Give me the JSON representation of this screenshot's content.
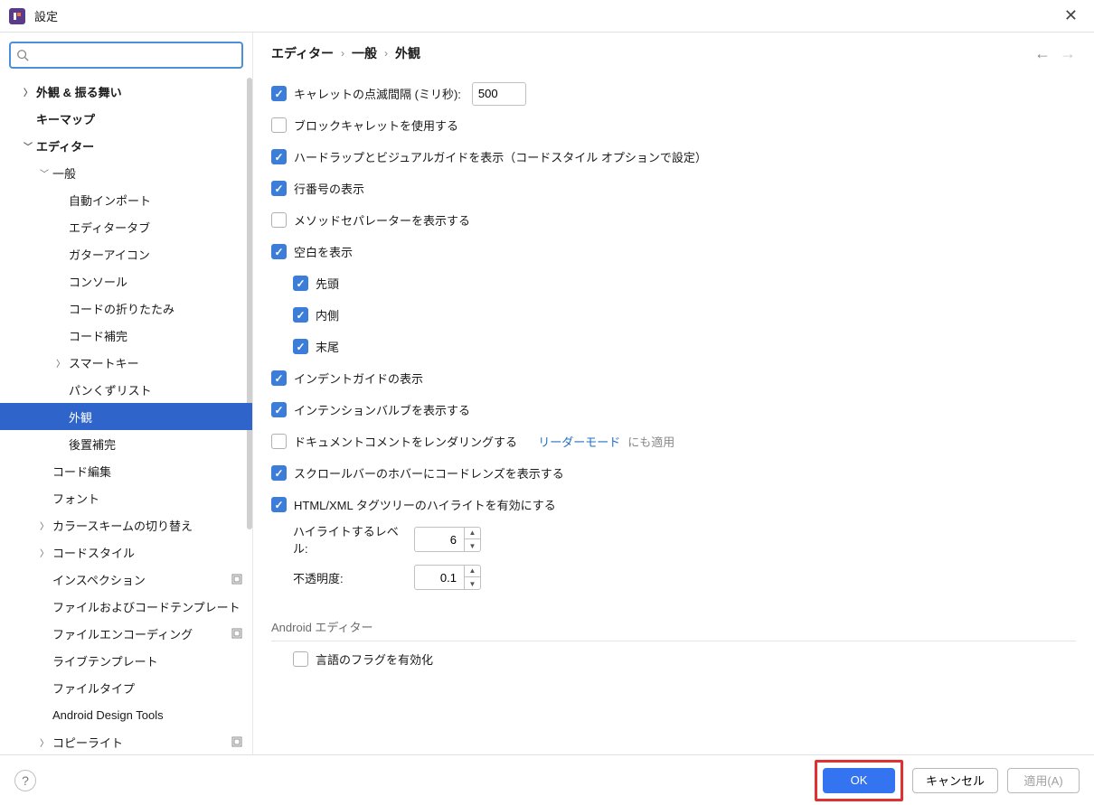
{
  "window": {
    "title": "設定"
  },
  "search": {
    "placeholder": ""
  },
  "tree": [
    {
      "label": "外観 & 振る舞い",
      "indent": 0,
      "expander": "right",
      "bold": true
    },
    {
      "label": "キーマップ",
      "indent": 0,
      "expander": "",
      "bold": true
    },
    {
      "label": "エディター",
      "indent": 0,
      "expander": "down",
      "bold": true
    },
    {
      "label": "一般",
      "indent": 1,
      "expander": "down"
    },
    {
      "label": "自動インポート",
      "indent": 2,
      "expander": ""
    },
    {
      "label": "エディタータブ",
      "indent": 2,
      "expander": ""
    },
    {
      "label": "ガターアイコン",
      "indent": 2,
      "expander": ""
    },
    {
      "label": "コンソール",
      "indent": 2,
      "expander": ""
    },
    {
      "label": "コードの折りたたみ",
      "indent": 2,
      "expander": ""
    },
    {
      "label": "コード補完",
      "indent": 2,
      "expander": ""
    },
    {
      "label": "スマートキー",
      "indent": 2,
      "expander": "right"
    },
    {
      "label": "パンくずリスト",
      "indent": 2,
      "expander": ""
    },
    {
      "label": "外観",
      "indent": 2,
      "expander": "",
      "selected": true
    },
    {
      "label": "後置補完",
      "indent": 2,
      "expander": ""
    },
    {
      "label": "コード編集",
      "indent": 1,
      "expander": ""
    },
    {
      "label": "フォント",
      "indent": 1,
      "expander": ""
    },
    {
      "label": "カラースキームの切り替え",
      "indent": 1,
      "expander": "right"
    },
    {
      "label": "コードスタイル",
      "indent": 1,
      "expander": "right"
    },
    {
      "label": "インスペクション",
      "indent": 1,
      "expander": "",
      "badge": true
    },
    {
      "label": "ファイルおよびコードテンプレート",
      "indent": 1,
      "expander": ""
    },
    {
      "label": "ファイルエンコーディング",
      "indent": 1,
      "expander": "",
      "badge": true
    },
    {
      "label": "ライブテンプレート",
      "indent": 1,
      "expander": ""
    },
    {
      "label": "ファイルタイプ",
      "indent": 1,
      "expander": ""
    },
    {
      "label": "Android Design Tools",
      "indent": 1,
      "expander": ""
    },
    {
      "label": "コピーライト",
      "indent": 1,
      "expander": "right",
      "badge": true
    }
  ],
  "breadcrumb": [
    "エディター",
    "一般",
    "外観"
  ],
  "options": {
    "caret_blink": {
      "label": "キャレットの点滅間隔 (ミリ秒):",
      "value": "500",
      "checked": true
    },
    "block_caret": {
      "label": "ブロックキャレットを使用する",
      "checked": false
    },
    "hardwrap": {
      "label": "ハードラップとビジュアルガイドを表示（コードスタイル オプションで設定）",
      "checked": true
    },
    "line_numbers": {
      "label": "行番号の表示",
      "checked": true
    },
    "method_sep": {
      "label": "メソッドセパレーターを表示する",
      "checked": false
    },
    "whitespace": {
      "label": "空白を表示",
      "checked": true
    },
    "ws_leading": {
      "label": "先頭",
      "checked": true
    },
    "ws_inner": {
      "label": "内側",
      "checked": true
    },
    "ws_trailing": {
      "label": "末尾",
      "checked": true
    },
    "indent_guides": {
      "label": "インデントガイドの表示",
      "checked": true
    },
    "intention_bulb": {
      "label": "インテンションバルブを表示する",
      "checked": true
    },
    "doc_render": {
      "label": "ドキュメントコメントをレンダリングする",
      "checked": false,
      "link": "リーダーモード",
      "link_suffix": "にも適用"
    },
    "codelens": {
      "label": "スクロールバーのホバーにコードレンズを表示する",
      "checked": true
    },
    "html_highlight": {
      "label": "HTML/XML タグツリーのハイライトを有効にする",
      "checked": true
    },
    "highlight_level": {
      "label": "ハイライトするレベル:",
      "value": "6"
    },
    "opacity": {
      "label": "不透明度:",
      "value": "0.1"
    },
    "android_section": "Android エディター",
    "lang_flags": {
      "label": "言語のフラグを有効化",
      "checked": false
    }
  },
  "footer": {
    "ok": "OK",
    "cancel": "キャンセル",
    "apply": "適用(A)"
  }
}
